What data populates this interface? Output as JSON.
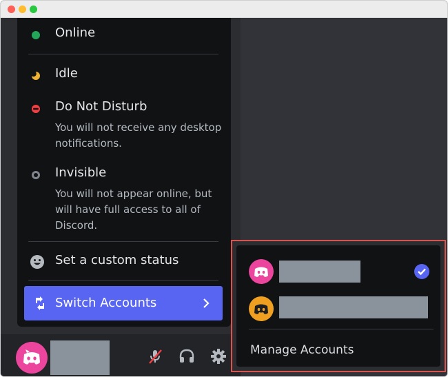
{
  "window": {
    "traffic_lights": [
      "close",
      "minimize",
      "zoom"
    ]
  },
  "status_menu": {
    "items": [
      {
        "icon": "online-status-icon",
        "label": "Online",
        "description": "",
        "color": "#23a55a"
      },
      {
        "icon": "idle-moon-icon",
        "label": "Idle",
        "description": "",
        "color": "#f0b232"
      },
      {
        "icon": "do-not-disturb-icon",
        "label": "Do Not Disturb",
        "description": "You will not receive any desktop notifications.",
        "color": "#f23f43"
      },
      {
        "icon": "invisible-status-icon",
        "label": "Invisible",
        "description": "You will not appear online, but will have full access to all of Discord.",
        "color": "#80848e"
      }
    ],
    "custom_status": {
      "icon": "smiley-icon",
      "label": "Set a custom status"
    },
    "switch_accounts": {
      "icon": "swap-accounts-icon",
      "label": "Switch Accounts"
    }
  },
  "user_panel": {
    "avatar": "discord-avatar-pink",
    "controls": [
      "mute-mic-icon",
      "headphones-icon",
      "settings-gear-icon"
    ],
    "mute_color": "#f23f43"
  },
  "accounts_panel": {
    "accounts": [
      {
        "avatar": "discord-avatar-pink",
        "selected": true
      },
      {
        "avatar": "discord-avatar-orange",
        "selected": false
      }
    ],
    "manage_label": "Manage Accounts",
    "highlight_color": "#d9534f",
    "check_color": "#5865f2"
  }
}
